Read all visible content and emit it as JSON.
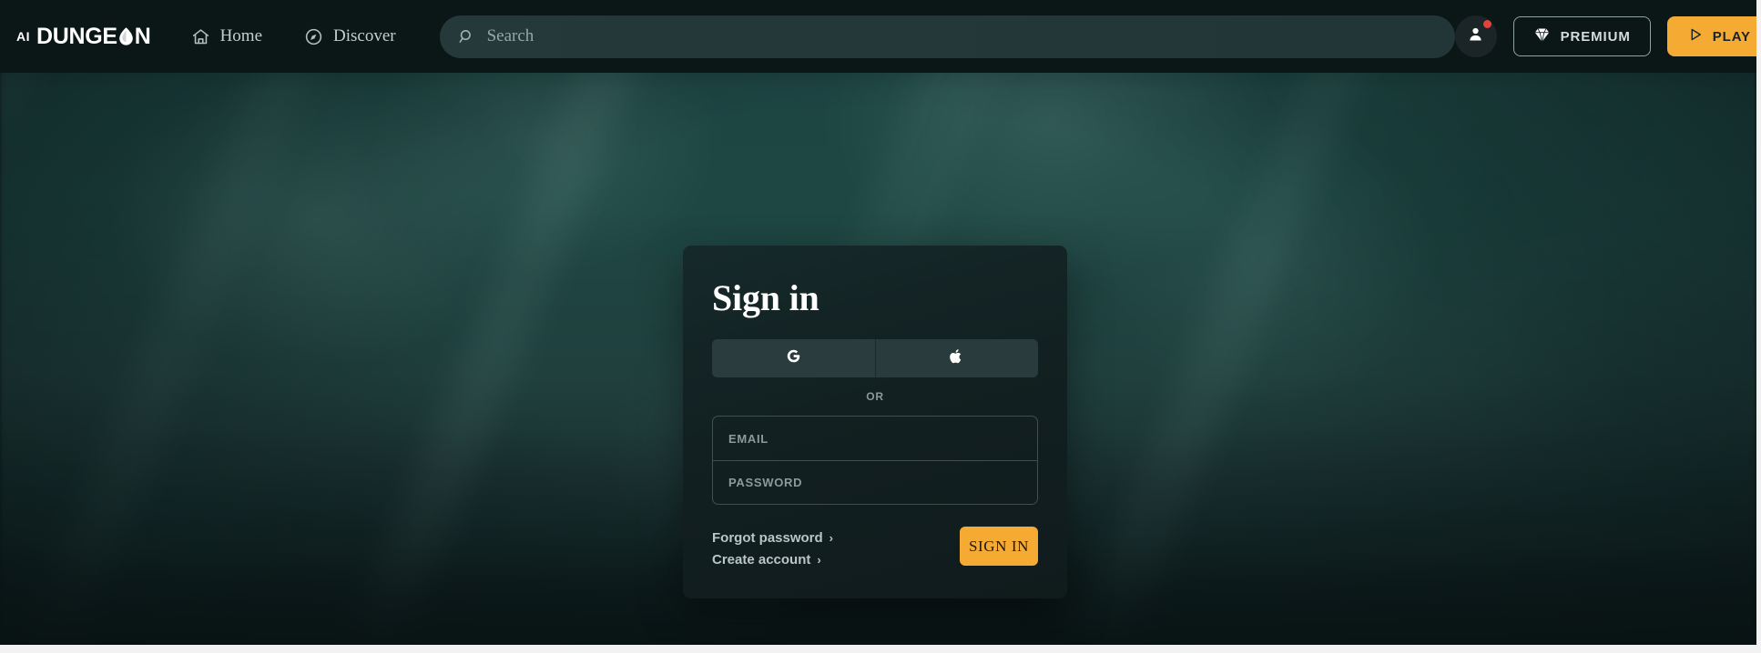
{
  "header": {
    "logo": {
      "prefix": "AI",
      "word_start": "DUNGE",
      "word_end": "N",
      "flame_icon": "flame-icon"
    },
    "nav": [
      {
        "label": "Home",
        "icon": "home-icon"
      },
      {
        "label": "Discover",
        "icon": "compass-icon"
      }
    ],
    "search": {
      "placeholder": "Search",
      "icon": "search-icon"
    },
    "avatar": {
      "icon": "user-icon",
      "notification": true
    },
    "premium_button": {
      "label": "PREMIUM",
      "icon": "gem-icon"
    },
    "play_button": {
      "label": "PLAY",
      "icon": "play-icon"
    }
  },
  "signin_card": {
    "title": "Sign in",
    "oauth": [
      {
        "name": "google",
        "icon": "google-g-icon"
      },
      {
        "name": "apple",
        "icon": "apple-icon"
      }
    ],
    "divider_text": "OR",
    "fields": [
      {
        "name": "email",
        "placeholder": "EMAIL",
        "value": ""
      },
      {
        "name": "password",
        "placeholder": "PASSWORD",
        "value": ""
      }
    ],
    "links": [
      {
        "label": "Forgot password",
        "chevron": "›"
      },
      {
        "label": "Create account",
        "chevron": "›"
      }
    ],
    "submit_button": {
      "label": "SIGN IN"
    }
  },
  "colors": {
    "accent": "#f5ab33",
    "header_bg": "#0b1617",
    "card_bg": "#12201f",
    "notification": "#e3423a",
    "background_teal": "#1e4744"
  }
}
